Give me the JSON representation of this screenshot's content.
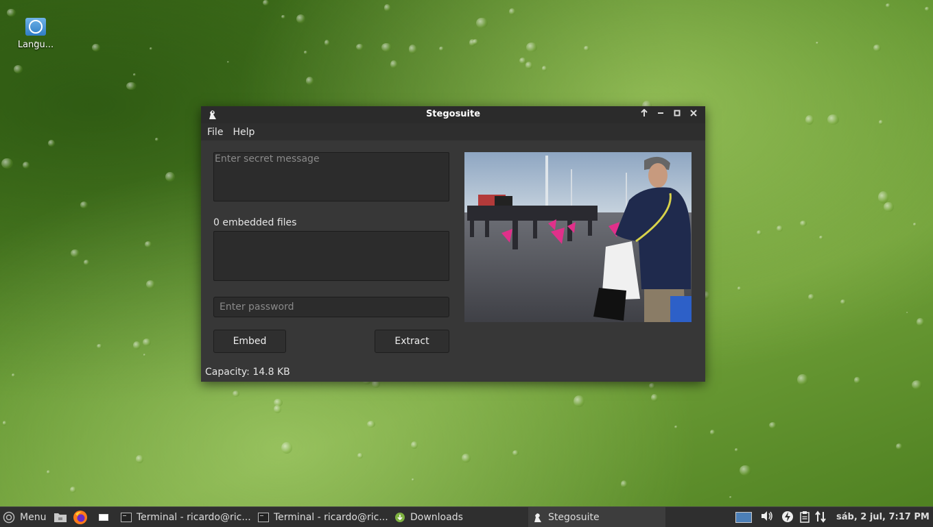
{
  "desktop": {
    "icon_label": "Langu..."
  },
  "window": {
    "title": "Stegosuite",
    "menu": [
      "File",
      "Help"
    ],
    "secret_message_placeholder": "Enter secret message",
    "embedded_files_label": "0 embedded files",
    "password_placeholder": "Enter password",
    "embed_button": "Embed",
    "extract_button": "Extract",
    "capacity": "Capacity: 14.8 KB"
  },
  "taskbar": {
    "menu_label": "Menu",
    "tasks": [
      {
        "label": "Terminal - ricardo@ric..."
      },
      {
        "label": "Terminal - ricardo@ric..."
      },
      {
        "label": "Downloads"
      },
      {
        "label": "Stegosuite"
      }
    ],
    "clock": "sáb,  2 jul,  7:17 PM"
  },
  "colors": {
    "window_bg": "#373737",
    "titlebar_bg": "#2b2b2b",
    "taskbar_bg": "#2f2f2f",
    "desktop_green": "#5a8e2a"
  }
}
